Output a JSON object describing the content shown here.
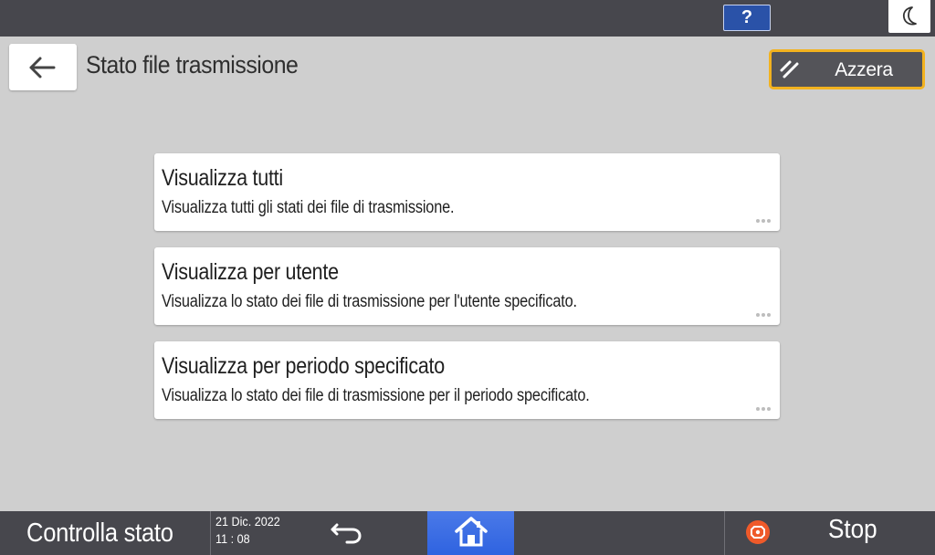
{
  "topbar": {
    "help_label": "?"
  },
  "header": {
    "title": "Stato file trasmissione",
    "reset_label": "Azzera"
  },
  "options": [
    {
      "title": "Visualizza tutti",
      "description": "Visualizza tutti gli stati dei file di trasmissione."
    },
    {
      "title": "Visualizza per utente",
      "description": "Visualizza lo stato dei file di trasmissione per l'utente specificato."
    },
    {
      "title": "Visualizza per periodo specificato",
      "description": "Visualizza lo stato dei file di trasmissione per il periodo specificato."
    }
  ],
  "bottombar": {
    "status_check_label": "Controlla stato",
    "date": "21 Dic. 2022",
    "time": "11 : 08",
    "stop_label": "Stop"
  },
  "colors": {
    "accent": "#f2b21f",
    "home": "#3468e2",
    "help": "#2a52a8",
    "stop": "#ef5a2a"
  }
}
